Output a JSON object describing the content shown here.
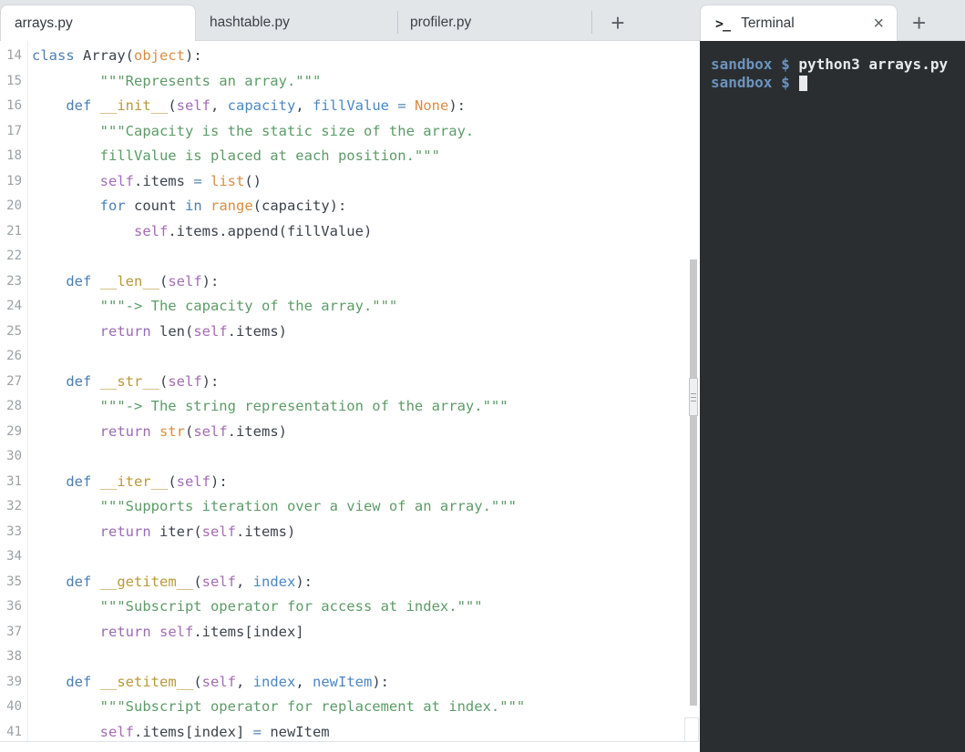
{
  "tabs": {
    "editor": [
      {
        "label": "arrays.py",
        "active": true
      },
      {
        "label": "hashtable.py",
        "active": false
      },
      {
        "label": "profiler.py",
        "active": false
      }
    ],
    "new_tab_label": "+",
    "terminal": {
      "icon": ">_",
      "label": "Terminal",
      "close": "×",
      "new_tab": "+"
    }
  },
  "editor": {
    "language": "python",
    "visible_line_range": [
      14,
      41
    ],
    "lines": [
      {
        "n": 14,
        "tokens": [
          [
            "kw",
            "class"
          ],
          [
            "pl",
            " Array("
          ],
          [
            "bi",
            "object"
          ],
          [
            "pl",
            "):"
          ]
        ]
      },
      {
        "n": 15,
        "tokens": [
          [
            "str",
            "        \"\"\"Represents an array.\"\"\""
          ]
        ]
      },
      {
        "n": 16,
        "tokens": [
          [
            "pl",
            "    "
          ],
          [
            "kw",
            "def"
          ],
          [
            "pl",
            " "
          ],
          [
            "fn",
            "__init__"
          ],
          [
            "pl",
            "("
          ],
          [
            "slf",
            "self"
          ],
          [
            "pl",
            ", "
          ],
          [
            "prm",
            "capacity"
          ],
          [
            "pl",
            ", "
          ],
          [
            "prm",
            "fillValue"
          ],
          [
            "op",
            " = "
          ],
          [
            "bi",
            "None"
          ],
          [
            "pl",
            "):"
          ]
        ]
      },
      {
        "n": 17,
        "tokens": [
          [
            "str",
            "        \"\"\"Capacity is the static size of the array."
          ]
        ]
      },
      {
        "n": 18,
        "tokens": [
          [
            "str",
            "        fillValue is placed at each position.\"\"\""
          ]
        ]
      },
      {
        "n": 19,
        "tokens": [
          [
            "pl",
            "        "
          ],
          [
            "slf",
            "self"
          ],
          [
            "pl",
            ".items "
          ],
          [
            "op",
            "="
          ],
          [
            "pl",
            " "
          ],
          [
            "bi",
            "list"
          ],
          [
            "pl",
            "()"
          ]
        ]
      },
      {
        "n": 20,
        "tokens": [
          [
            "pl",
            "        "
          ],
          [
            "kw",
            "for"
          ],
          [
            "pl",
            " count "
          ],
          [
            "kw",
            "in"
          ],
          [
            "pl",
            " "
          ],
          [
            "bi",
            "range"
          ],
          [
            "pl",
            "(capacity):"
          ]
        ]
      },
      {
        "n": 21,
        "tokens": [
          [
            "pl",
            "            "
          ],
          [
            "slf",
            "self"
          ],
          [
            "pl",
            ".items.append(fillValue)"
          ]
        ]
      },
      {
        "n": 22,
        "tokens": []
      },
      {
        "n": 23,
        "tokens": [
          [
            "pl",
            "    "
          ],
          [
            "kw",
            "def"
          ],
          [
            "pl",
            " "
          ],
          [
            "fn",
            "__len__"
          ],
          [
            "pl",
            "("
          ],
          [
            "slf",
            "self"
          ],
          [
            "pl",
            "):"
          ]
        ]
      },
      {
        "n": 24,
        "tokens": [
          [
            "str",
            "        \"\"\"-> The capacity of the array.\"\"\""
          ]
        ]
      },
      {
        "n": 25,
        "tokens": [
          [
            "pl",
            "        "
          ],
          [
            "ret",
            "return"
          ],
          [
            "pl",
            " len("
          ],
          [
            "slf",
            "self"
          ],
          [
            "pl",
            ".items)"
          ]
        ]
      },
      {
        "n": 26,
        "tokens": []
      },
      {
        "n": 27,
        "tokens": [
          [
            "pl",
            "    "
          ],
          [
            "kw",
            "def"
          ],
          [
            "pl",
            " "
          ],
          [
            "fn",
            "__str__"
          ],
          [
            "pl",
            "("
          ],
          [
            "slf",
            "self"
          ],
          [
            "pl",
            "):"
          ]
        ]
      },
      {
        "n": 28,
        "tokens": [
          [
            "str",
            "        \"\"\"-> The string representation of the array.\"\"\""
          ]
        ]
      },
      {
        "n": 29,
        "tokens": [
          [
            "pl",
            "        "
          ],
          [
            "ret",
            "return"
          ],
          [
            "pl",
            " "
          ],
          [
            "bi",
            "str"
          ],
          [
            "pl",
            "("
          ],
          [
            "slf",
            "self"
          ],
          [
            "pl",
            ".items)"
          ]
        ]
      },
      {
        "n": 30,
        "tokens": []
      },
      {
        "n": 31,
        "tokens": [
          [
            "pl",
            "    "
          ],
          [
            "kw",
            "def"
          ],
          [
            "pl",
            " "
          ],
          [
            "fn",
            "__iter__"
          ],
          [
            "pl",
            "("
          ],
          [
            "slf",
            "self"
          ],
          [
            "pl",
            "):"
          ]
        ]
      },
      {
        "n": 32,
        "tokens": [
          [
            "str",
            "        \"\"\"Supports iteration over a view of an array.\"\"\""
          ]
        ]
      },
      {
        "n": 33,
        "tokens": [
          [
            "pl",
            "        "
          ],
          [
            "ret",
            "return"
          ],
          [
            "pl",
            " iter("
          ],
          [
            "slf",
            "self"
          ],
          [
            "pl",
            ".items)"
          ]
        ]
      },
      {
        "n": 34,
        "tokens": []
      },
      {
        "n": 35,
        "tokens": [
          [
            "pl",
            "    "
          ],
          [
            "kw",
            "def"
          ],
          [
            "pl",
            " "
          ],
          [
            "fn",
            "__getitem__"
          ],
          [
            "pl",
            "("
          ],
          [
            "slf",
            "self"
          ],
          [
            "pl",
            ", "
          ],
          [
            "prm",
            "index"
          ],
          [
            "pl",
            "):"
          ]
        ]
      },
      {
        "n": 36,
        "tokens": [
          [
            "str",
            "        \"\"\"Subscript operator for access at index.\"\"\""
          ]
        ]
      },
      {
        "n": 37,
        "tokens": [
          [
            "pl",
            "        "
          ],
          [
            "ret",
            "return"
          ],
          [
            "pl",
            " "
          ],
          [
            "slf",
            "self"
          ],
          [
            "pl",
            ".items[index]"
          ]
        ]
      },
      {
        "n": 38,
        "tokens": []
      },
      {
        "n": 39,
        "tokens": [
          [
            "pl",
            "    "
          ],
          [
            "kw",
            "def"
          ],
          [
            "pl",
            " "
          ],
          [
            "fn",
            "__setitem__"
          ],
          [
            "pl",
            "("
          ],
          [
            "slf",
            "self"
          ],
          [
            "pl",
            ", "
          ],
          [
            "prm",
            "index"
          ],
          [
            "pl",
            ", "
          ],
          [
            "prm",
            "newItem"
          ],
          [
            "pl",
            "):"
          ]
        ]
      },
      {
        "n": 40,
        "tokens": [
          [
            "str",
            "        \"\"\"Subscript operator for replacement at index.\"\"\""
          ]
        ]
      },
      {
        "n": 41,
        "tokens": [
          [
            "pl",
            "        "
          ],
          [
            "slf",
            "self"
          ],
          [
            "pl",
            ".items[index] "
          ],
          [
            "op",
            "="
          ],
          [
            "pl",
            " newItem"
          ]
        ]
      }
    ]
  },
  "terminal": {
    "lines": [
      {
        "prompt": "sandbox $",
        "command": "python3 arrays.py",
        "cursor": false
      },
      {
        "prompt": "sandbox $",
        "command": "",
        "cursor": true
      }
    ]
  },
  "colors": {
    "kw": "#4a7fb5",
    "ret": "#9a6bb5",
    "slf": "#a46cb5",
    "fn": "#b8993a",
    "bi": "#d98d43",
    "str": "#5d9b68",
    "prm": "#4c87c5",
    "op": "#5585b5",
    "pl": "#3c434c",
    "ln": "#9ba1a6",
    "tabbar": "#e3e6e9",
    "tabactive": "#ffffff",
    "termbg": "#2a2e31",
    "termprompt": "#6d93bc",
    "termtext": "#e8eaed"
  }
}
